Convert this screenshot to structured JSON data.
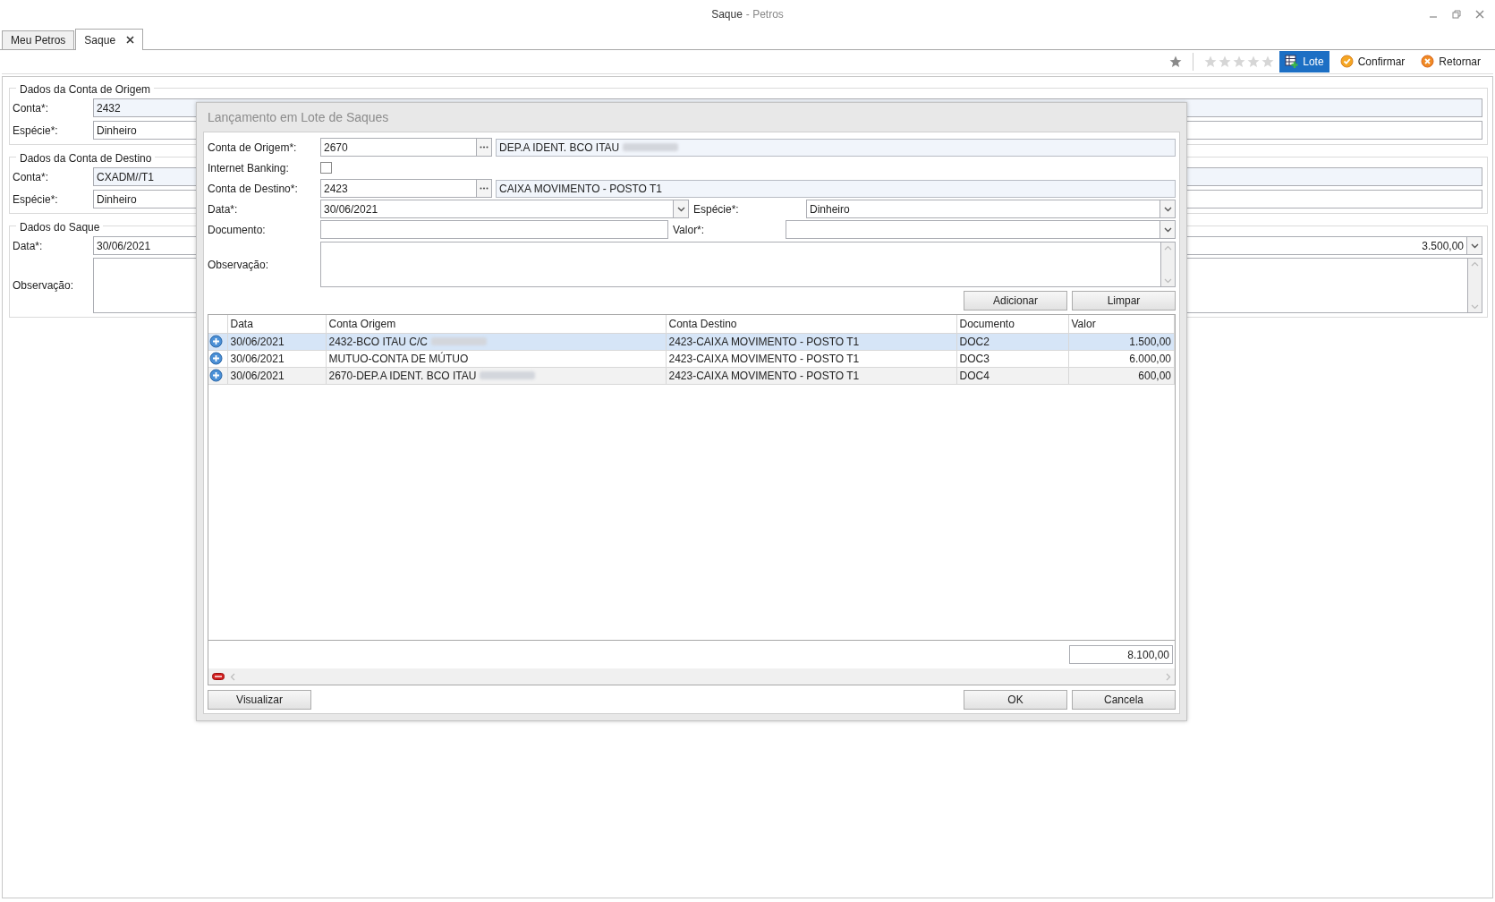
{
  "window": {
    "title": "Saque",
    "app_name": "- Petros"
  },
  "tabs": [
    {
      "label": "Meu Petros",
      "selected": false,
      "closable": false
    },
    {
      "label": "Saque",
      "selected": true,
      "closable": true
    }
  ],
  "toolbar": {
    "rating": {
      "stars": 0
    },
    "buttons": [
      {
        "label": "Lote",
        "kind": "lote",
        "selected": true
      },
      {
        "label": "Confirmar",
        "kind": "confirm",
        "selected": false
      },
      {
        "label": "Retornar",
        "kind": "return",
        "selected": false
      }
    ]
  },
  "form": {
    "sections": [
      {
        "title": "Dados da Conta de Origem",
        "fields": [
          {
            "kind": "text",
            "label": "Conta*:",
            "value": "2432",
            "readonly": true
          },
          {
            "kind": "text",
            "label": "Espécie*:",
            "value": "Dinheiro",
            "readonly": false
          }
        ]
      },
      {
        "title": "Dados da Conta de Destino",
        "fields": [
          {
            "kind": "text",
            "label": "Conta*:",
            "value": "CXADM//T1",
            "readonly": true
          },
          {
            "kind": "text",
            "label": "Espécie*:",
            "value": "Dinheiro",
            "readonly": false
          }
        ]
      },
      {
        "title": "Dados do Saque",
        "fields": [
          {
            "kind": "date_amount",
            "label": "Data*:",
            "value": "30/06/2021",
            "amount": "3.500,00"
          },
          {
            "kind": "memo",
            "label": "Observação:"
          }
        ]
      }
    ]
  },
  "modal": {
    "title": "Lançamento em Lote de Saques",
    "conta_origem": {
      "label": "Conta de Origem*:",
      "value": "2670",
      "description": "DEP.A IDENT. BCO ITAU",
      "redacted": true
    },
    "internet_banking": {
      "label": "Internet Banking:",
      "checked": false
    },
    "conta_destino": {
      "label": "Conta de Destino*:",
      "value": "2423",
      "description": "CAIXA MOVIMENTO - POSTO T1",
      "redacted": false
    },
    "data": {
      "label": "Data*:",
      "value": "30/06/2021"
    },
    "especie": {
      "label": "Espécie*:",
      "value": "Dinheiro"
    },
    "documento": {
      "label": "Documento:"
    },
    "valor": {
      "label": "Valor*:"
    },
    "observacao": {
      "label": "Observação:"
    },
    "buttons_top": [
      "Adicionar",
      "Limpar"
    ],
    "grid": {
      "columns": [
        "Data",
        "Conta Origem",
        "Conta Destino",
        "Documento",
        "Valor"
      ],
      "rows": [
        {
          "data": "30/06/2021",
          "conta_origem": "2432-BCO ITAU C/C",
          "redacted": true,
          "conta_destino": "2423-CAIXA MOVIMENTO - POSTO T1",
          "documento": "DOC2",
          "valor": "1.500,00",
          "selected": true
        },
        {
          "data": "30/06/2021",
          "conta_origem": "MUTUO-CONTA DE MÚTUO",
          "redacted": false,
          "conta_destino": "2423-CAIXA MOVIMENTO - POSTO T1",
          "documento": "DOC3",
          "valor": "6.000,00",
          "selected": false
        },
        {
          "data": "30/06/2021",
          "conta_origem": "2670-DEP.A IDENT. BCO ITAU",
          "redacted": true,
          "conta_destino": "2423-CAIXA MOVIMENTO - POSTO T1",
          "documento": "DOC4",
          "valor": "600,00",
          "selected": false
        }
      ],
      "total": "8.100,00"
    },
    "buttons_left": [
      "Visualizar"
    ],
    "buttons_right": [
      "OK",
      "Cancela"
    ]
  }
}
